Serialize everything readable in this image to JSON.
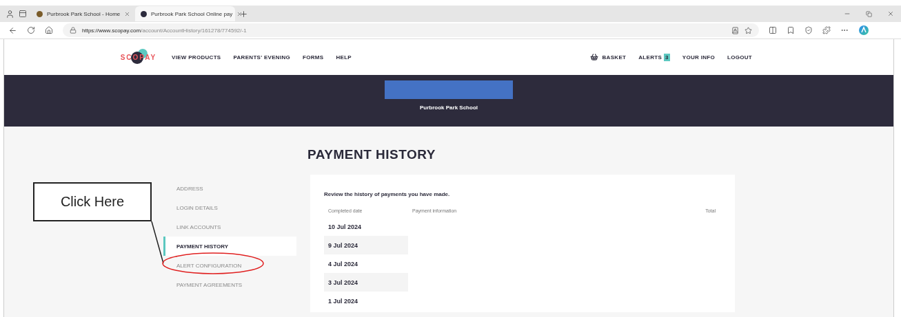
{
  "browser": {
    "tabs": [
      {
        "title": "Purbrook Park School - Home",
        "selected": false
      },
      {
        "title": "Purbrook Park School Online pay",
        "selected": true
      }
    ],
    "url_host": "https://www.scopay.com",
    "url_path": "/account/AccountHistory/161278/774592/-1"
  },
  "nav": {
    "logo": "SCOPAY",
    "links": [
      "VIEW PRODUCTS",
      "PARENTS' EVENING",
      "FORMS",
      "HELP"
    ],
    "basket": "BASKET",
    "alerts": {
      "label": "ALERTS",
      "count": "3"
    },
    "account_links": [
      "YOUR INFO",
      "LOGOUT"
    ]
  },
  "banner": {
    "school_name": "Purbrook Park School"
  },
  "page_title": "PAYMENT HISTORY",
  "sidebar": {
    "items": [
      {
        "label": "ADDRESS",
        "selected": false
      },
      {
        "label": "LOGIN DETAILS",
        "selected": false
      },
      {
        "label": "LINK ACCOUNTS",
        "selected": false
      },
      {
        "label": "PAYMENT HISTORY",
        "selected": true
      },
      {
        "label": "ALERT CONFIGURATION",
        "selected": false,
        "circled": true
      },
      {
        "label": "PAYMENT AGREEMENTS",
        "selected": false
      }
    ]
  },
  "content": {
    "intro": "Review the history of payments you have made.",
    "columns": [
      "Completed date",
      "Payment information",
      "Total"
    ],
    "rows": [
      "10 Jul 2024",
      "9 Jul 2024",
      "4 Jul 2024",
      "3 Jul 2024",
      "1 Jul 2024"
    ]
  },
  "annotation": {
    "callout": "Click Here"
  }
}
